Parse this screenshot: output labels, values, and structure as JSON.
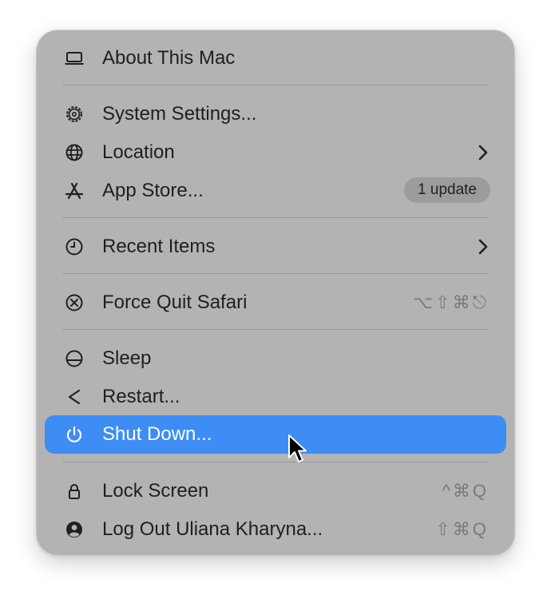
{
  "menu": {
    "about": {
      "label": "About This Mac",
      "icon": "laptop-icon"
    },
    "system_settings": {
      "label": "System Settings...",
      "icon": "gear-icon"
    },
    "location": {
      "label": "Location",
      "icon": "globe-icon",
      "submenu": true
    },
    "app_store": {
      "label": "App Store...",
      "icon": "app-store-icon",
      "badge": "1 update"
    },
    "recent_items": {
      "label": "Recent Items",
      "icon": "clock-icon",
      "submenu": true
    },
    "force_quit": {
      "label": "Force Quit Safari",
      "icon": "force-quit-icon",
      "shortcut": "⌥⇧⌘⎋"
    },
    "sleep": {
      "label": "Sleep",
      "icon": "sleep-icon"
    },
    "restart": {
      "label": "Restart...",
      "icon": "restart-icon"
    },
    "shut_down": {
      "label": "Shut Down...",
      "icon": "power-icon",
      "highlighted": true
    },
    "lock_screen": {
      "label": "Lock Screen",
      "icon": "lock-icon",
      "shortcut": "^⌘Q"
    },
    "log_out": {
      "label": "Log Out Uliana Kharyna...",
      "icon": "user-icon",
      "shortcut": "⇧⌘Q"
    }
  },
  "colors": {
    "menu_background": "#b3b3b3",
    "highlight": "#3d8df5",
    "text": "#1f1f1f",
    "shortcut_text": "#7a7a7a",
    "badge_background": "#9c9c9c"
  }
}
